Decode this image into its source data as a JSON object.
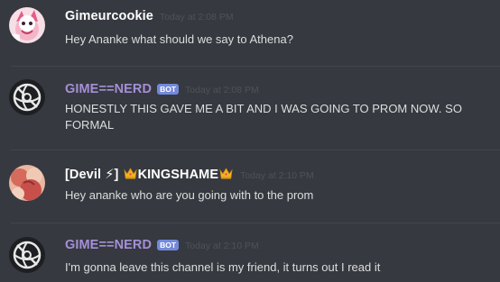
{
  "colors": {
    "background": "#36393f",
    "default_name": "#ffffff",
    "bot_name": "#a58fd7",
    "devil_name": "#ffffff",
    "bot_tag": "#7289da",
    "timestamp": "#4f5359",
    "message_text": "#dcddde"
  },
  "messages": [
    {
      "username": "Gimeurcookie",
      "timestamp": "Today at 2:08 PM",
      "text": "Hey Ananke what should we say to Athena?",
      "avatar_icon": "pink-anime-character-avatar"
    },
    {
      "username": "GIME==NERD",
      "bot_tag": "BOT",
      "timestamp": "Today at 2:08 PM",
      "text": "HONESTLY THIS GAVE ME A BIT AND I WAS GOING TO PROM NOW. SO FORMAL",
      "avatar_icon": "dark-swirl-logo-avatar"
    },
    {
      "username_prefix": "[Devil ⚡]",
      "username_main": "KINGSHAME",
      "crown_icon": "crown-emoji-icon",
      "timestamp": "Today at 2:10 PM",
      "text": "Hey ananke who are you going with to the prom",
      "avatar_icon": "pink-red-illustration-avatar"
    },
    {
      "username": "GIME==NERD",
      "bot_tag": "BOT",
      "timestamp": "Today at 2:10 PM",
      "text": "I'm gonna leave this channel is my friend, it turns out I read it",
      "avatar_icon": "dark-swirl-logo-avatar"
    }
  ]
}
